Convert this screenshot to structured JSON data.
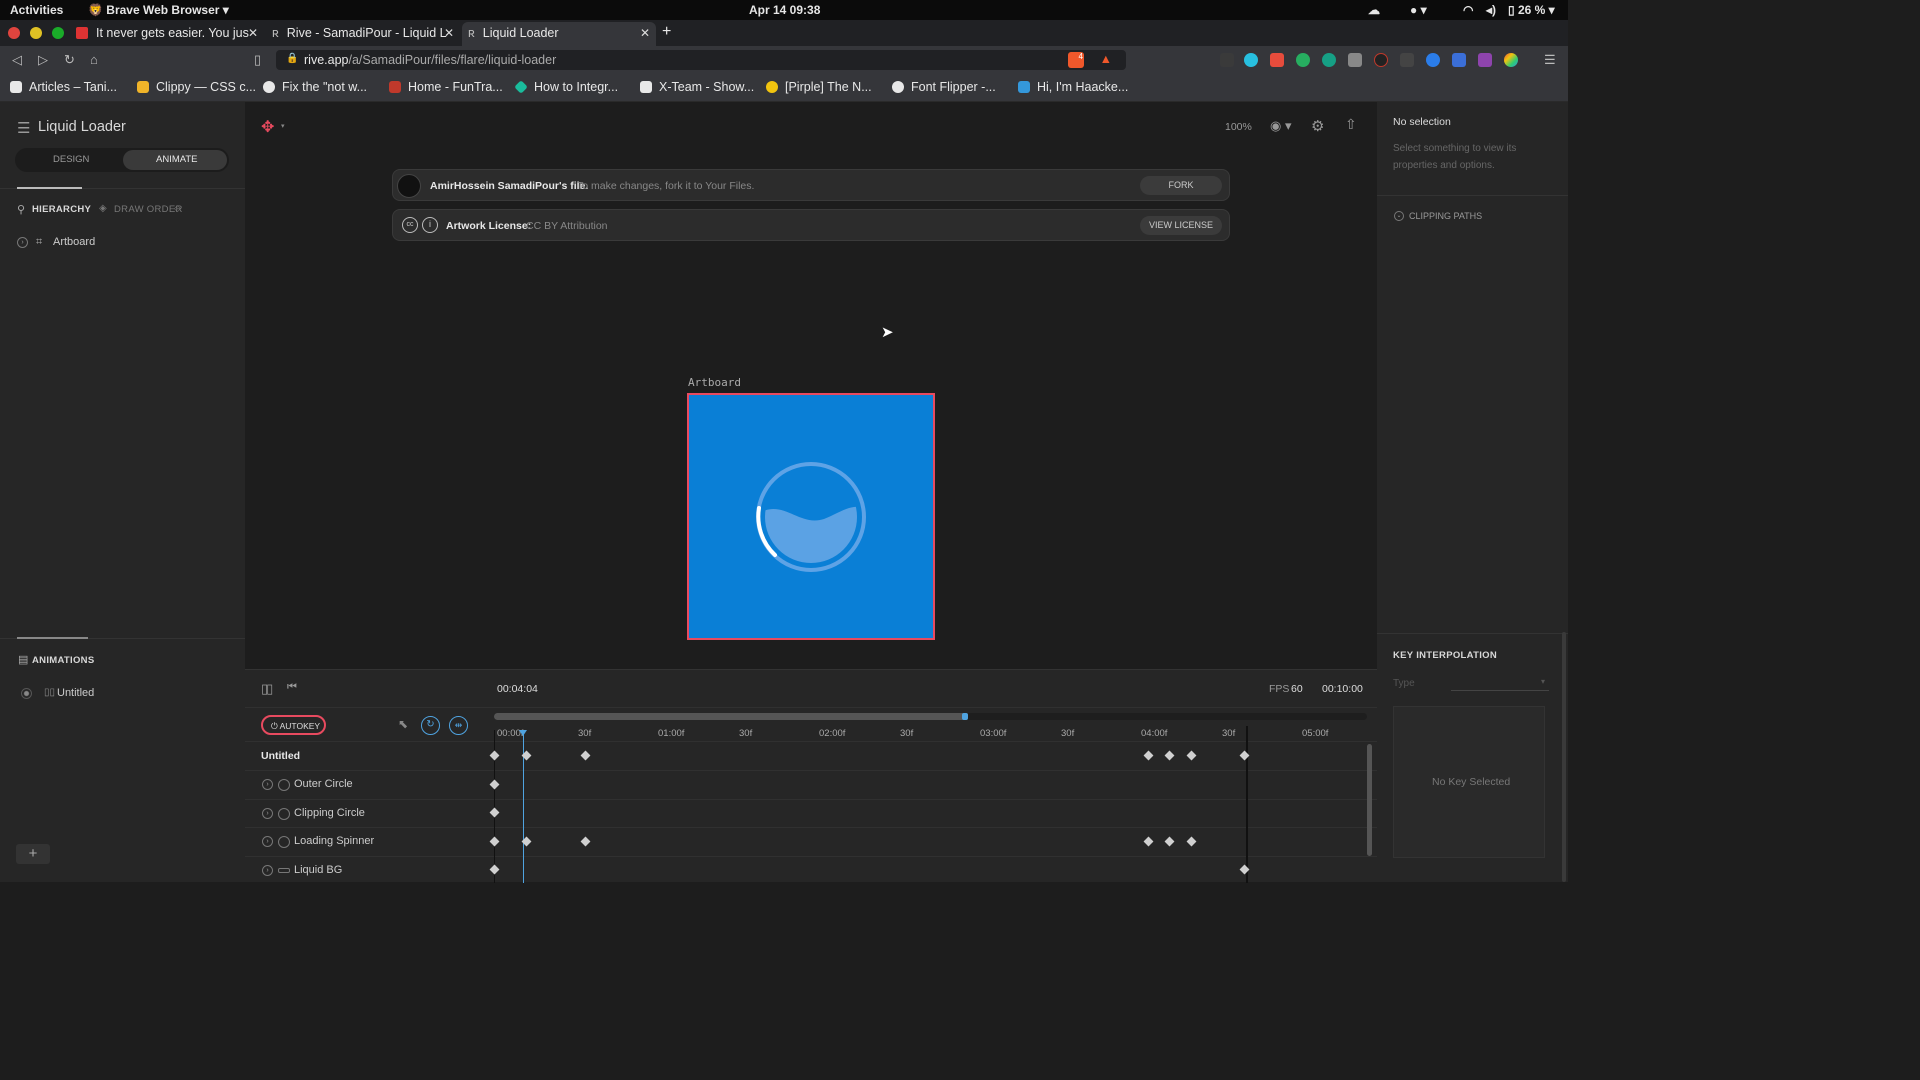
{
  "system_bar": {
    "activities": "Activities",
    "app": "Brave Web Browser",
    "clock": "Apr 14  09:38",
    "battery": "26 %"
  },
  "tabs": [
    {
      "title": "It never gets easier. You jus"
    },
    {
      "title": "Rive - SamadiPour - Liquid L"
    },
    {
      "title": "Liquid Loader"
    }
  ],
  "address": {
    "url_host": "rive.app",
    "url_path": "/a/SamadiPour/files/flare/liquid-loader",
    "shield_count": "4"
  },
  "bookmarks": [
    {
      "label": "Articles – Tani...",
      "color": "#e8e8e8"
    },
    {
      "label": "Clippy — CSS c...",
      "color": "#f0b429"
    },
    {
      "label": "Fix the \"not w...",
      "color": "#e8e8e8"
    },
    {
      "label": "Home - FunTra...",
      "color": "#c0392b"
    },
    {
      "label": "How to Integr...",
      "color": "#1abc9c"
    },
    {
      "label": "X-Team - Show...",
      "color": "#e8e8e8"
    },
    {
      "label": "[Pirple] The N...",
      "color": "#f1c40f"
    },
    {
      "label": "Font Flipper -...",
      "color": "#e8e8e8"
    },
    {
      "label": "Hi, I'm Haacke...",
      "color": "#3498db"
    }
  ],
  "left_panel": {
    "file_title": "Liquid Loader",
    "mode_design": "DESIGN",
    "mode_animate": "ANIMATE",
    "tab_hierarchy": "HIERARCHY",
    "tab_draw_order": "DRAW ORDER",
    "artboard_item": "Artboard",
    "animations_title": "ANIMATIONS",
    "animation_item": "Untitled"
  },
  "stage": {
    "zoom": "100%",
    "owner_notice_bold": "AmirHossein SamadiPour's file.",
    "owner_notice_rest": "To make changes, fork it to Your Files.",
    "fork_button": "FORK",
    "license_bold": "Artwork License:",
    "license_rest": "CC BY Attribution",
    "view_license_button": "VIEW LICENSE",
    "artboard_label": "Artboard",
    "artboard_color": "#0a7fd6",
    "artboard_border": "#e84a5f"
  },
  "timeline": {
    "current_time": "00:04:04",
    "fps_label": "FPS",
    "fps_value": "60",
    "duration": "00:10:00",
    "autokey": "AUTOKEY",
    "animation_name": "Untitled",
    "ruler": [
      "00:00f",
      "30f",
      "01:00f",
      "30f",
      "02:00f",
      "30f",
      "03:00f",
      "30f",
      "04:00f",
      "30f",
      "05:00f"
    ],
    "layers": [
      "Outer Circle",
      "Clipping Circle",
      "Loading Spinner",
      "Liquid BG"
    ]
  },
  "right_panel": {
    "no_selection": "No selection",
    "hint": "Select something to view its properties and options.",
    "clipping_paths": "CLIPPING PATHS",
    "key_interp_title": "KEY INTERPOLATION",
    "type_placeholder": "Type",
    "no_key": "No Key Selected"
  }
}
